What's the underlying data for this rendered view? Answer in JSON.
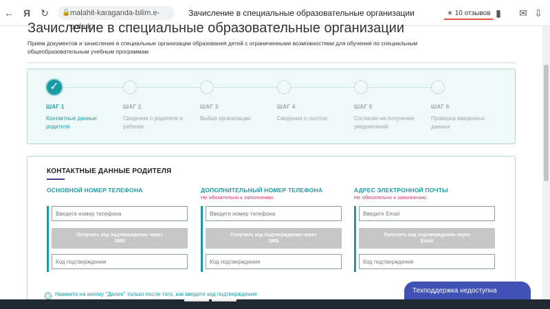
{
  "browser": {
    "url": "malahit-karaganda-bilim.e-orda.kz",
    "tab_title": "Зачисление в специальные образовательные организации",
    "rating": "10 отзывов",
    "icons": [
      "back-icon",
      "yandex-icon",
      "reload-icon",
      "lock-icon",
      "chat-icon",
      "download-icon",
      "bookmark-icon",
      "menu-icon"
    ]
  },
  "page": {
    "title": "Зачисление в специальные образовательные организации",
    "description": "Прием документов и зачисление в специальные организации образования детей с ограниченными возможностями для обучения по специальным общеобразовательным учебным программам"
  },
  "steps": [
    {
      "num": "ШАГ 1",
      "label": "Контактные данные родителя",
      "status": "done"
    },
    {
      "num": "ШАГ 2",
      "label": "Сведения о родителе и ребенке",
      "status": "pending"
    },
    {
      "num": "ШАГ 3",
      "label": "Выбор организации",
      "status": "pending"
    },
    {
      "num": "ШАГ 4",
      "label": "Сведения о льготах",
      "status": "pending"
    },
    {
      "num": "ШАГ 5",
      "label": "Согласие на получение уведомлений",
      "status": "pending"
    },
    {
      "num": "ШАГ 6",
      "label": "Проверка введенных данных",
      "status": "pending"
    }
  ],
  "contact": {
    "title": "КОНТАКТНЫЕ ДАННЫЕ РОДИТЕЛЯ",
    "columns": [
      {
        "head": "ОСНОВНОЙ НОМЕР ТЕЛЕФОНА",
        "sub": "",
        "input_placeholder": "Введите номер телефона",
        "button": "Получить код подтверждения через SMS",
        "code_placeholder": "Код подтверждения"
      },
      {
        "head": "ДОПОЛНИТЕЛЬНЫЙ НОМЕР ТЕЛЕФОНА",
        "sub": "Не обязательно к заполнению",
        "input_placeholder": "Введите номер телефона",
        "button": "Получить код подтверждения через SMS",
        "code_placeholder": "Код подтверждения"
      },
      {
        "head": "АДРЕС ЭЛЕКТРОННОЙ ПОЧТЫ",
        "sub": "Не обязательно к заполнению",
        "input_placeholder": "Введите Email",
        "button": "Получить код подтверждения через Email",
        "code_placeholder": "Код подтверждения"
      }
    ],
    "hint": "Нажмите на кнопку \"Далее\" только после того, как введете код подтверждения"
  },
  "support": {
    "label": "Техподдержка недоступна"
  },
  "colors": {
    "accent": "#1a9aa5",
    "optional": "#e0306b",
    "support_bg": "#3f51b5",
    "disabled_button": "#c6c6c6"
  }
}
